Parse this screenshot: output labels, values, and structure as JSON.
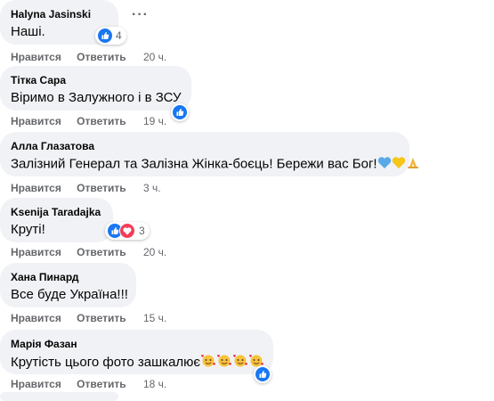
{
  "actions": {
    "like": "Нравится",
    "reply": "Ответить"
  },
  "comments": [
    {
      "author": "Halyna Jasinski",
      "text": "Наші.",
      "time": "20 ч.",
      "reactions": [
        "like-icon"
      ],
      "reaction_count": "4"
    },
    {
      "author": "Тітка Сара",
      "text": "Віримо в Залужного і в ЗСУ",
      "time": "19 ч.",
      "reactions": [
        "like-icon"
      ],
      "reaction_count": ""
    },
    {
      "author": "Алла Глазатова",
      "text": "Залізний Генерал та Залізна Жінка-боєць! Бережи вас Бог!",
      "time": "3 ч.",
      "emojis": [
        "blue-heart-emoji",
        "yellow-heart-emoji",
        "folded-hands-emoji"
      ]
    },
    {
      "author": "Ksenija Taradajka",
      "text": "Круті!",
      "time": "20 ч.",
      "reactions": [
        "like-icon",
        "love-icon"
      ],
      "reaction_count": "3"
    },
    {
      "author": "Хана Пинард",
      "text": "Все буде Україна!!!",
      "time": "15 ч."
    },
    {
      "author": "Марія Фазан",
      "text": "Крутість цього фото зашкалює",
      "time": "18 ч.",
      "reactions": [
        "like-icon"
      ],
      "reaction_count": "",
      "emojis": [
        "smiling-face-with-hearts-emoji",
        "smiling-face-with-hearts-emoji",
        "smiling-face-with-hearts-emoji",
        "smiling-face-with-hearts-emoji"
      ]
    }
  ],
  "more_options_label": "···"
}
